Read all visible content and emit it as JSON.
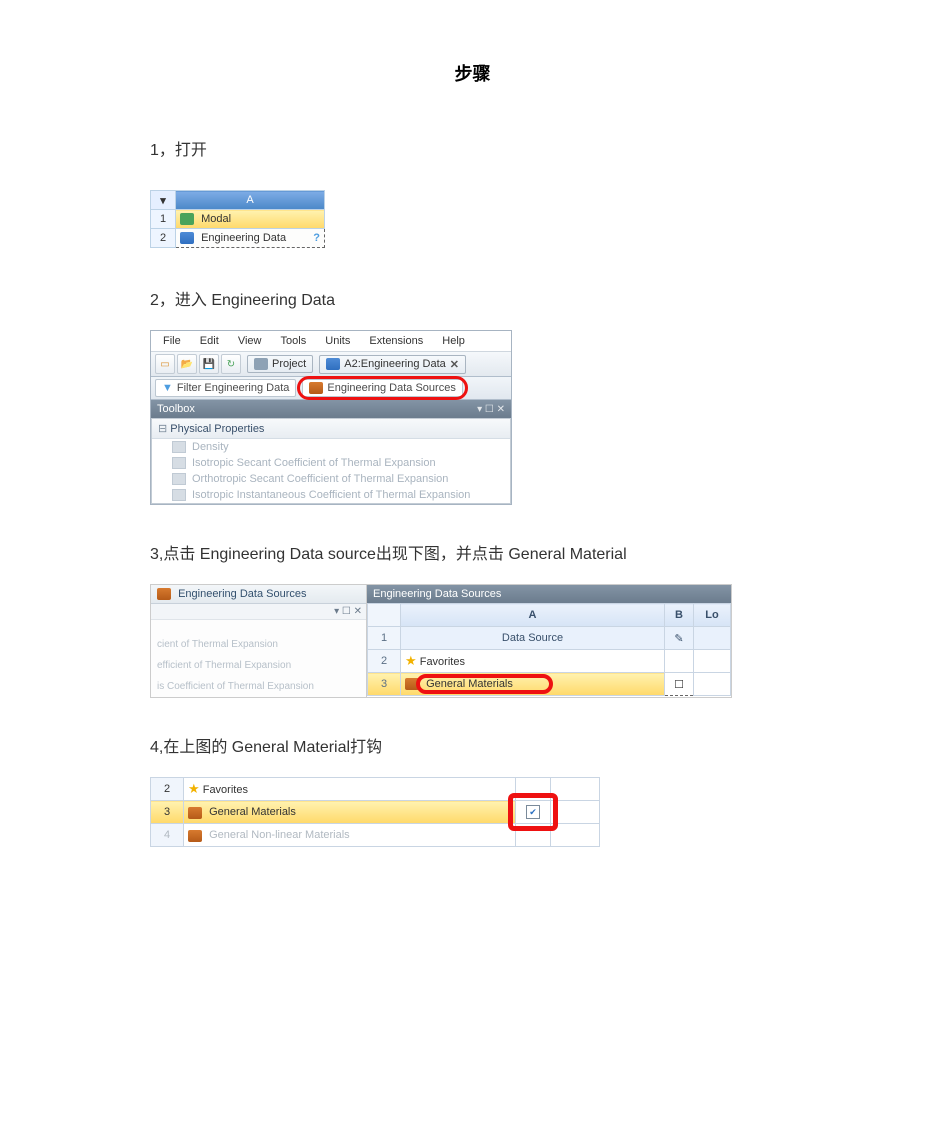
{
  "doc": {
    "title": "步骤",
    "steps": {
      "s1": "1，打开",
      "s2": "2，进入 Engineering Data",
      "s3": "3,点击 Engineering Data source出现下图，并点击 General Material",
      "s4": "4,在上图的 General Material打钩"
    }
  },
  "shot1": {
    "col_header": "A",
    "row1_num": "1",
    "row1_label": "Modal",
    "row2_num": "2",
    "row2_label": "Engineering Data",
    "row2_status": "?"
  },
  "shot2": {
    "menu": {
      "file": "File",
      "edit": "Edit",
      "view": "View",
      "tools": "Tools",
      "units": "Units",
      "extensions": "Extensions",
      "help": "Help"
    },
    "project_tab": "Project",
    "a2_tab": "A2:Engineering Data",
    "filter_chip": "Filter Engineering Data",
    "sources_chip": "Engineering Data Sources",
    "toolbox_title": "Toolbox",
    "tree_head": "Physical Properties",
    "tree_items": {
      "i0": "Density",
      "i1": "Isotropic Secant Coefficient of Thermal Expansion",
      "i2": "Orthotropic Secant Coefficient of Thermal Expansion",
      "i3": "Isotropic Instantaneous Coefficient of Thermal Expansion"
    }
  },
  "shot3": {
    "left_header": "Engineering Data Sources",
    "left_sub": "▾ ☐ ✕",
    "faded": {
      "l0": "cient of Thermal Expansion",
      "l1": "efficient of Thermal Expansion",
      "l2": "is Coefficient of Thermal Expansion"
    },
    "pane_title": "Engineering Data Sources",
    "col_a": "A",
    "col_b": "B",
    "col_c_frag": "Lo",
    "row1_num": "1",
    "row1_label": "Data Source",
    "row1_b": "✎",
    "row2_num": "2",
    "row2_label": "Favorites",
    "row3_num": "3",
    "row3_label": "General Materials",
    "row3_chk": "☐"
  },
  "shot4": {
    "row2_num": "2",
    "row2_label": "Favorites",
    "row3_num": "3",
    "row3_label": "General Materials",
    "row3_chk": "✔",
    "row4_num": "4",
    "row4_label": "General Non-linear Materials"
  }
}
